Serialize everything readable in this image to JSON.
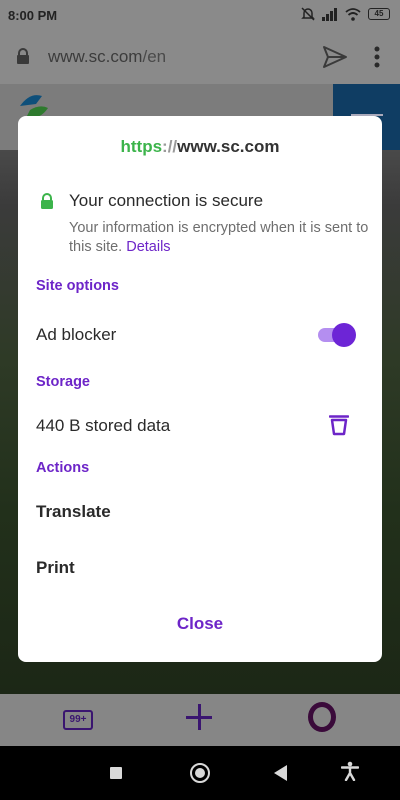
{
  "status_bar": {
    "time": "8:00 PM",
    "battery": "45"
  },
  "browser": {
    "url_host": "www.sc.com",
    "url_path": "/en",
    "tab_count": "99+"
  },
  "dialog": {
    "title_scheme": "https",
    "title_separator": "://",
    "title_host": "www.sc.com",
    "secure_heading": "Your connection is secure",
    "secure_description": "Your information is encrypted when it is sent to this site.",
    "details_link": "Details",
    "site_options_heading": "Site options",
    "ad_blocker_label": "Ad blocker",
    "ad_blocker_enabled": true,
    "storage_heading": "Storage",
    "stored_data_label": "440 B stored data",
    "actions_heading": "Actions",
    "translate_label": "Translate",
    "print_label": "Print",
    "close_label": "Close"
  },
  "colors": {
    "accent": "#6d25c8",
    "secure_green": "#3cb44b",
    "scrim": "#8a8a8a"
  },
  "icons": {
    "lock": "lock-icon",
    "send": "send-icon",
    "more": "more-vert-icon",
    "trash": "trash-icon",
    "secure_lock": "lock-icon"
  }
}
